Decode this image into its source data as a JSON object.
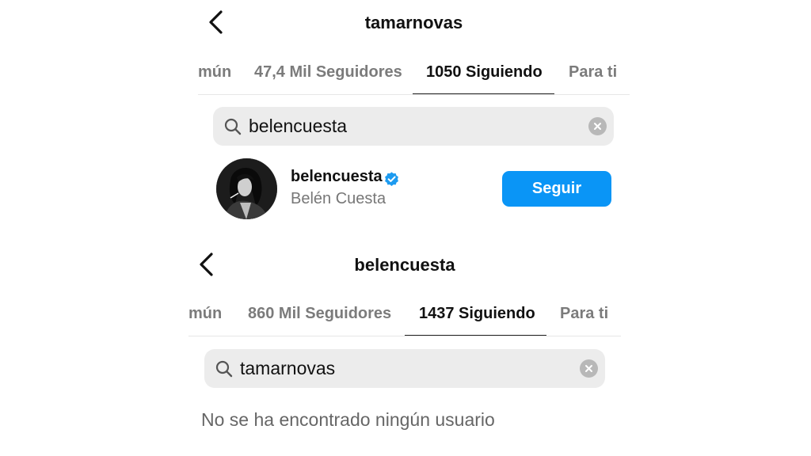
{
  "top": {
    "title": "tamarnovas",
    "tabs": [
      {
        "label": "mún",
        "active": false
      },
      {
        "label": "47,4 Mil Seguidores",
        "active": false
      },
      {
        "label": "1050 Siguiendo",
        "active": true
      },
      {
        "label": "Para ti",
        "active": false
      }
    ],
    "search": {
      "query": "belencuesta"
    },
    "result": {
      "username": "belencuesta",
      "full_name": "Belén Cuesta",
      "verified": true,
      "follow_label": "Seguir"
    }
  },
  "bottom": {
    "title": "belencuesta",
    "tabs": [
      {
        "label": "mún",
        "active": false
      },
      {
        "label": "860 Mil Seguidores",
        "active": false
      },
      {
        "label": "1437 Siguiendo",
        "active": true
      },
      {
        "label": "Para ti",
        "active": false
      }
    ],
    "search": {
      "query": "tamarnovas"
    },
    "empty_message": "No se ha encontrado ningún usuario"
  },
  "icons": {
    "back": "chevron-left-icon",
    "search": "search-icon",
    "clear": "clear-icon",
    "verified": "verified-badge-icon"
  },
  "colors": {
    "accent": "#0a95f6",
    "verified": "#1d9bf0",
    "search_bg": "#ececec",
    "muted_text": "#7b7b7b"
  }
}
